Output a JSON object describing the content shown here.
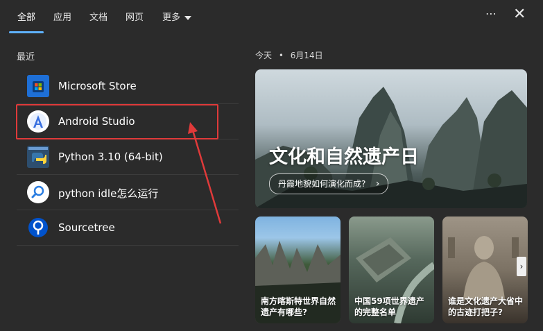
{
  "tabs": [
    {
      "label": "全部"
    },
    {
      "label": "应用"
    },
    {
      "label": "文档"
    },
    {
      "label": "网页"
    },
    {
      "label": "更多"
    }
  ],
  "recent": {
    "title": "最近",
    "items": [
      {
        "label": "Microsoft Store",
        "icon": "microsoft-store-icon"
      },
      {
        "label": "Android Studio",
        "icon": "android-studio-icon"
      },
      {
        "label": "Python 3.10 (64-bit)",
        "icon": "python-icon"
      },
      {
        "label": "python idle怎么运行",
        "icon": "search-icon"
      },
      {
        "label": "Sourcetree",
        "icon": "sourcetree-icon"
      }
    ]
  },
  "today": {
    "label": "今天",
    "separator": "•",
    "date": "6月14日"
  },
  "hero": {
    "title": "文化和自然遗产日",
    "button": "丹霞地貌如何演化而成?",
    "chevron": "›"
  },
  "cards": [
    {
      "caption": "南方喀斯特世界自然遗产有哪些?"
    },
    {
      "caption": "中国59项世界遗产的完整名单"
    },
    {
      "caption": "谁是文化遗产大省中的古迹打把子?"
    }
  ],
  "icons": {
    "more_options": "⋯",
    "close": "✕",
    "scroll_right": "›"
  },
  "colors": {
    "accent": "#5fb2ff",
    "highlight": "#e03a3a",
    "background": "#2b2b2b"
  }
}
